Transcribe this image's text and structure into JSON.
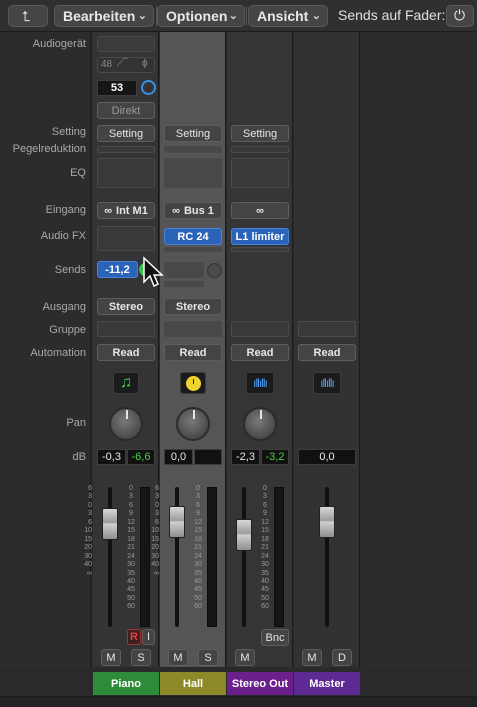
{
  "toolbar": {
    "edit_menu": "Bearbeiten",
    "options_menu": "Optionen",
    "view_menu": "Ansicht",
    "sends_on_faders_label": "Sends auf Fader:"
  },
  "labels": {
    "audio_device": "Audiogerät",
    "setting": "Setting",
    "gain_reduction": "Pegelreduktion",
    "eq": "EQ",
    "input": "Eingang",
    "audio_fx": "Audio FX",
    "sends": "Sends",
    "output": "Ausgang",
    "group": "Gruppe",
    "automation": "Automation",
    "pan": "Pan",
    "db": "dB"
  },
  "piano_strip": {
    "sample_rate": "48",
    "input_monitor_value": "53",
    "direct_label": "Direkt",
    "setting": "Setting",
    "input": "Int M1",
    "send_value": "-11,2",
    "output": "Stereo",
    "automation": "Read",
    "volume_db": "-0,3",
    "peak_db": "-6,6",
    "record_label": "R",
    "input_monitor_label": "I",
    "mute_label": "M",
    "solo_label": "S",
    "name": "Piano",
    "name_color": "#2e8b3a"
  },
  "hall_strip": {
    "setting": "Setting",
    "input": "Bus 1",
    "audio_fx": "RC 24",
    "output": "Stereo",
    "automation": "Read",
    "volume_db": "0,0",
    "mute_label": "M",
    "solo_label": "S",
    "name": "Hall",
    "name_color": "#8c8a28"
  },
  "stereo_out_strip": {
    "setting": "Setting",
    "audio_fx": "L1 limiter",
    "automation": "Read",
    "volume_db": "-2,3",
    "peak_db": "-3,2",
    "bounce_label": "Bnc",
    "mute_label": "M",
    "name": "Stereo Out",
    "name_color": "#6a1f8a"
  },
  "master_strip": {
    "automation": "Read",
    "volume_db": "0,0",
    "mute_label": "M",
    "dim_label": "D",
    "name": "Master",
    "name_color": "#5d2a94"
  },
  "fader_scale": [
    "6",
    "3",
    "0",
    "3",
    "6",
    "10",
    "15",
    "20",
    "30",
    "40",
    "∞"
  ],
  "meter_scale": [
    "0",
    "3",
    "6",
    "9",
    "12",
    "15",
    "18",
    "21",
    "24",
    "30",
    "35",
    "40",
    "45",
    "50",
    "60"
  ],
  "icons": {
    "piano_track_icon": "music-note-icon",
    "hall_track_icon": "clock-icon",
    "stereo_out_track_icon": "waveform-icon",
    "master_track_icon": "waveform-icon"
  }
}
